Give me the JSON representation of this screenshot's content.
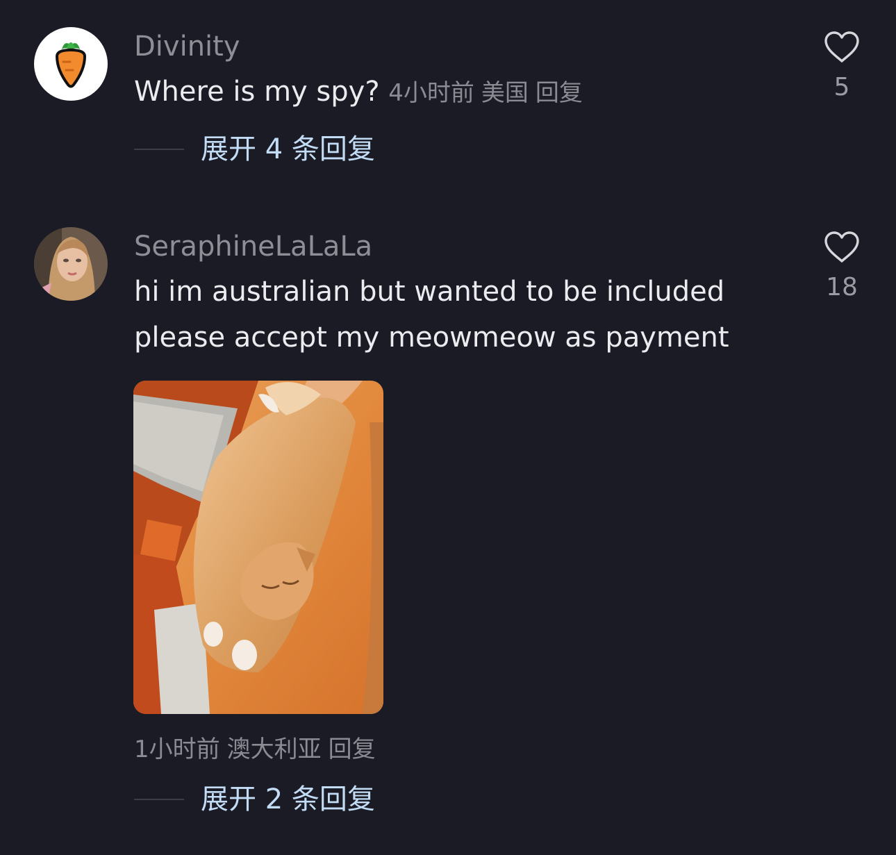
{
  "comments": [
    {
      "username": "Divinity",
      "avatar_icon": "carrot-icon",
      "text_lines": [
        "Where is my spy?"
      ],
      "time": "4小时前",
      "location": "美国",
      "reply_label": "回复",
      "likes": "5",
      "expand_label": "展开 4 条回复"
    },
    {
      "username": "SeraphineLaLaLa",
      "avatar_icon": "profile-photo",
      "text_lines": [
        "hi im australian but wanted to be included",
        "please accept my meowmeow as payment"
      ],
      "time": "1小时前",
      "location": "澳大利亚",
      "reply_label": "回复",
      "likes": "18",
      "expand_label": "展开 2 条回复"
    }
  ],
  "colors": {
    "background": "#1a1b24",
    "username": "#8d8e96",
    "text": "#ececf0",
    "meta": "#8a8b93",
    "expand_link": "#c3dcf5"
  }
}
